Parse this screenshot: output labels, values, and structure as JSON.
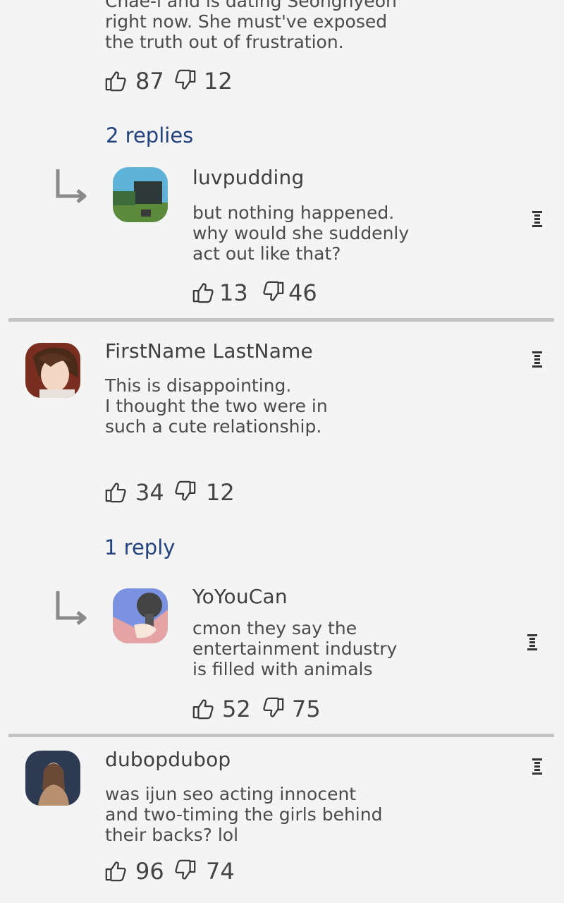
{
  "top_comment": {
    "text": "Chae-i and is dating Seonghyeon\nright now. She must've exposed\nthe truth out of frustration.",
    "likes": "87",
    "dislikes": "12",
    "replies_label": "2 replies",
    "reply": {
      "username": "luvpudding",
      "text": "but nothing happened.\nwhy would she suddenly\nact out like that?",
      "likes": "13",
      "dislikes": "46"
    }
  },
  "comment2": {
    "username": "FirstName LastName",
    "text": "This is disappointing.\nI thought the two were in\nsuch a cute relationship.",
    "likes": "34",
    "dislikes": "12",
    "replies_label": "1 reply",
    "reply": {
      "username": "YoYouCan",
      "text": "cmon they say the\nentertainment industry\nis filled with animals",
      "likes": "52",
      "dislikes": "75"
    }
  },
  "comment3": {
    "username": "dubopdubop",
    "text": "was ijun seo acting innocent\nand two-timing the girls behind\ntheir backs? lol",
    "likes": "96",
    "dislikes": "74"
  },
  "colors": {
    "background": "#f4f4f4",
    "reply_link": "#22427e",
    "separator": "#c4c4c4"
  },
  "icons": [
    "thumbs-up-icon",
    "thumbs-down-icon",
    "reply-arrow-icon",
    "menu-icon"
  ]
}
